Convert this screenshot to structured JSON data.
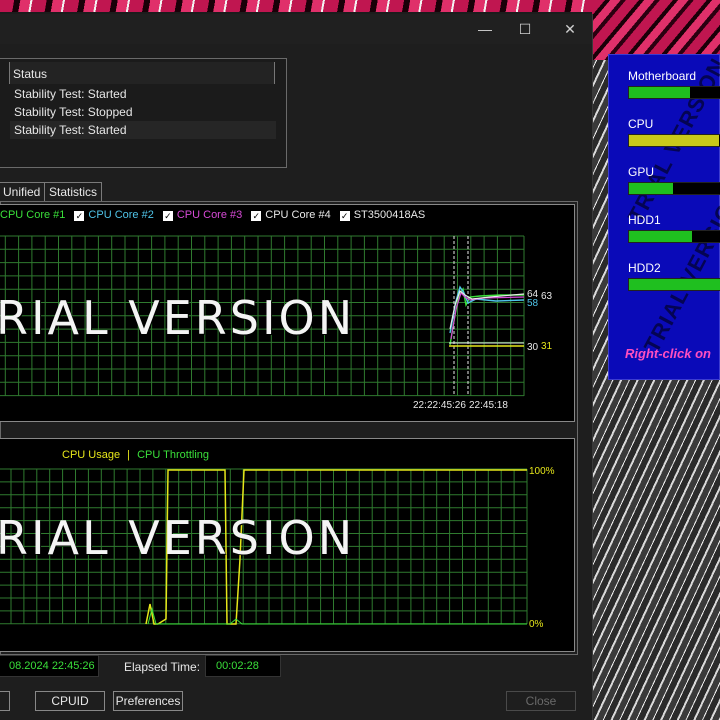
{
  "window": {
    "controls": {
      "minimize": "—",
      "maximize": "☐",
      "close": "✕"
    }
  },
  "status": {
    "header": "Status",
    "rows": [
      "Stability Test: Started",
      "Stability Test: Stopped",
      "Stability Test: Started"
    ]
  },
  "tabs": [
    "Unified",
    "Statistics"
  ],
  "temp_graph": {
    "legend": [
      {
        "label": "CPU Core #1",
        "color": "#3adf3a"
      },
      {
        "label": "CPU Core #2",
        "color": "#4fc3e8"
      },
      {
        "label": "CPU Core #3",
        "color": "#d64ad6"
      },
      {
        "label": "CPU Core #4",
        "color": "#e8e8e8"
      },
      {
        "label": "ST3500418AS",
        "color": "#e8e8e8"
      }
    ],
    "watermark": "RIAL VERSION",
    "values_right": [
      "64",
      "63",
      "58",
      "30",
      "31"
    ],
    "time_label_a": "22:45:26",
    "time_label_b": "22:45:18",
    "time_label_overlap": "22:",
    "gridline_color": "#2f7a2f"
  },
  "usage_graph": {
    "legend_usage": "CPU Usage",
    "legend_sep": "|",
    "legend_throttling": "CPU Throttling",
    "watermark": "RIAL VERSION",
    "top_label": "100%",
    "bottom_label": "0%"
  },
  "footer": {
    "start_time": "08.2024 22:45:26",
    "elapsed_label": "Elapsed Time:",
    "elapsed_value": "00:02:28",
    "buttons": {
      "cpuid": "CPUID",
      "preferences": "Preferences",
      "close": "Close"
    }
  },
  "gadget": {
    "items": [
      {
        "label": "Motherboard",
        "fill": 0.62,
        "color": "#1fbf1f"
      },
      {
        "label": "CPU",
        "fill": 0.92,
        "color": "#c8c81a"
      },
      {
        "label": "GPU",
        "fill": 0.45,
        "color": "#1fbf1f"
      },
      {
        "label": "HDD1",
        "fill": 0.64,
        "color": "#1fbf1f"
      },
      {
        "label": "HDD2",
        "fill": 0.98,
        "color": "#1fbf1f"
      }
    ],
    "hint": "Right-click on"
  }
}
